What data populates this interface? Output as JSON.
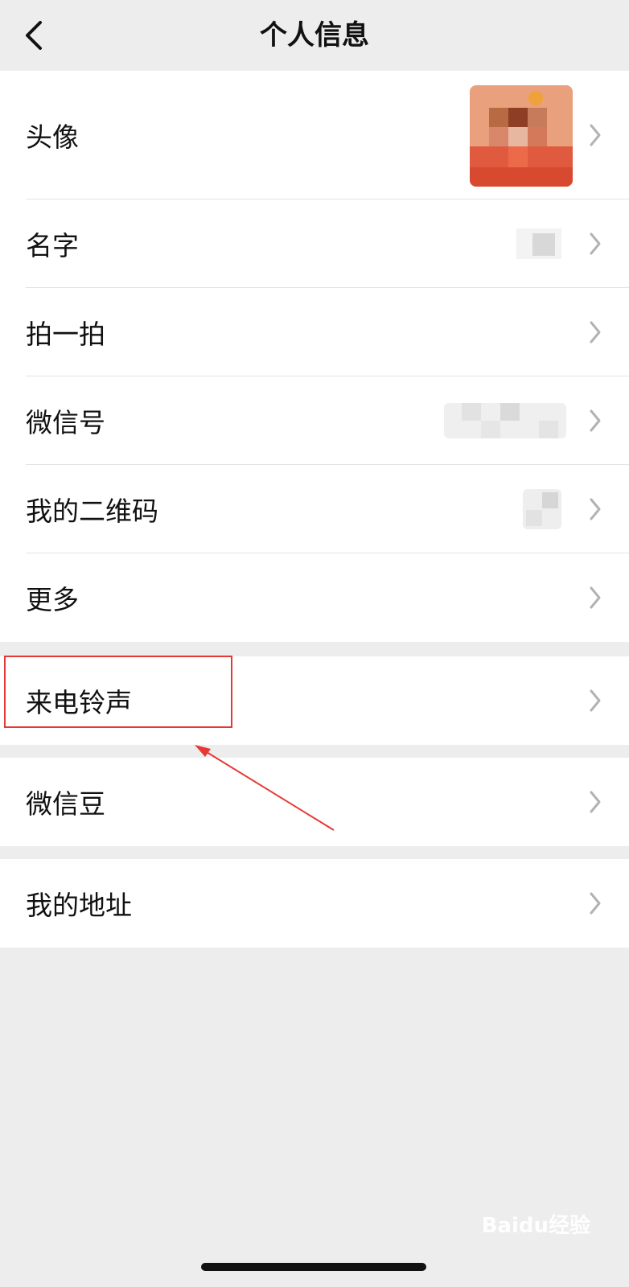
{
  "nav": {
    "title": "个人信息",
    "back_icon": "chevron-left-icon"
  },
  "rows_group1": [
    {
      "key": "avatar",
      "label": "头像"
    },
    {
      "key": "name",
      "label": "名字"
    },
    {
      "key": "pat",
      "label": "拍一拍"
    },
    {
      "key": "wechat_id",
      "label": "微信号"
    },
    {
      "key": "qr",
      "label": "我的二维码"
    },
    {
      "key": "more",
      "label": "更多"
    }
  ],
  "row_ringtone": {
    "label": "来电铃声"
  },
  "row_beans": {
    "label": "微信豆"
  },
  "row_address": {
    "label": "我的地址"
  },
  "annotation": {
    "highlight_color": "#e53935"
  },
  "watermark": "Baidu经验"
}
